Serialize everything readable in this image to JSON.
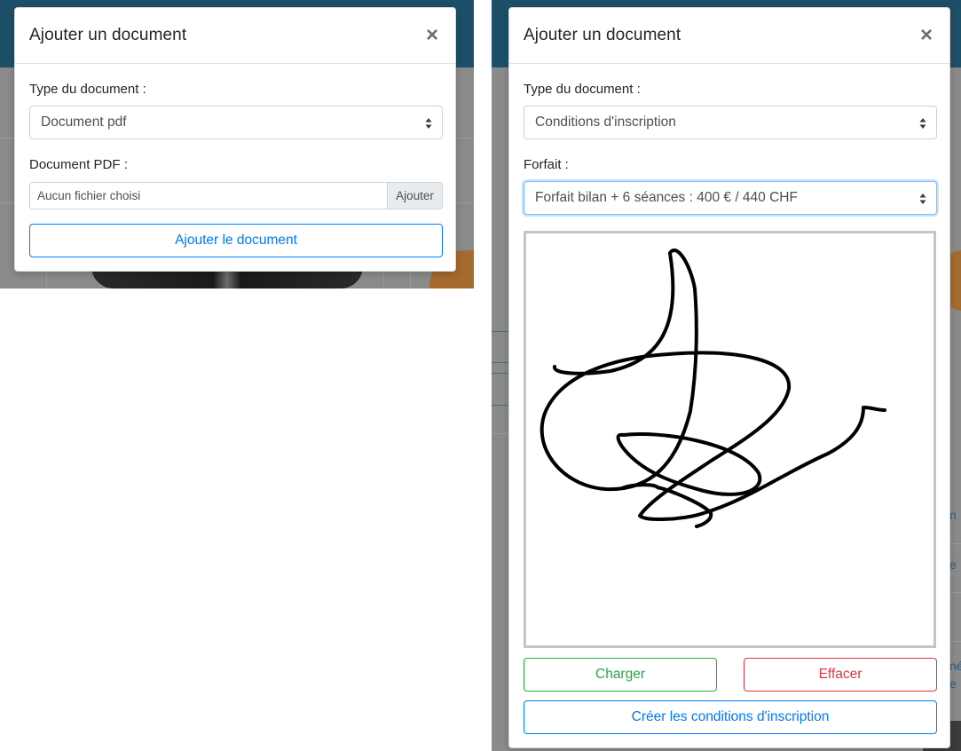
{
  "left_modal": {
    "title": "Ajouter un document",
    "close_symbol": "×",
    "doc_type_label": "Type du document :",
    "doc_type_value": "Document pdf",
    "pdf_label": "Document PDF :",
    "file_placeholder": "Aucun fichier choisi",
    "file_button": "Ajouter",
    "submit_label": "Ajouter le document"
  },
  "right_modal": {
    "title": "Ajouter un document",
    "close_symbol": "×",
    "doc_type_label": "Type du document :",
    "doc_type_value": "Conditions d'inscription",
    "forfait_label": "Forfait :",
    "forfait_value": "Forfait bilan + 6 séances : 400 € / 440 CHF",
    "load_label": "Charger",
    "clear_label": "Effacer",
    "create_label": "Créer les conditions d'inscription"
  },
  "background": {
    "partial_texts": [
      "n",
      "e",
      "né",
      "e"
    ]
  },
  "colors": {
    "primary": "#007bff",
    "success": "#28a745",
    "danger": "#dc3545",
    "header_band": "#1d4f68",
    "backdrop": "#8a8a8a"
  },
  "icons": {
    "select_arrows": "select-updown-icon",
    "close": "close-icon"
  }
}
